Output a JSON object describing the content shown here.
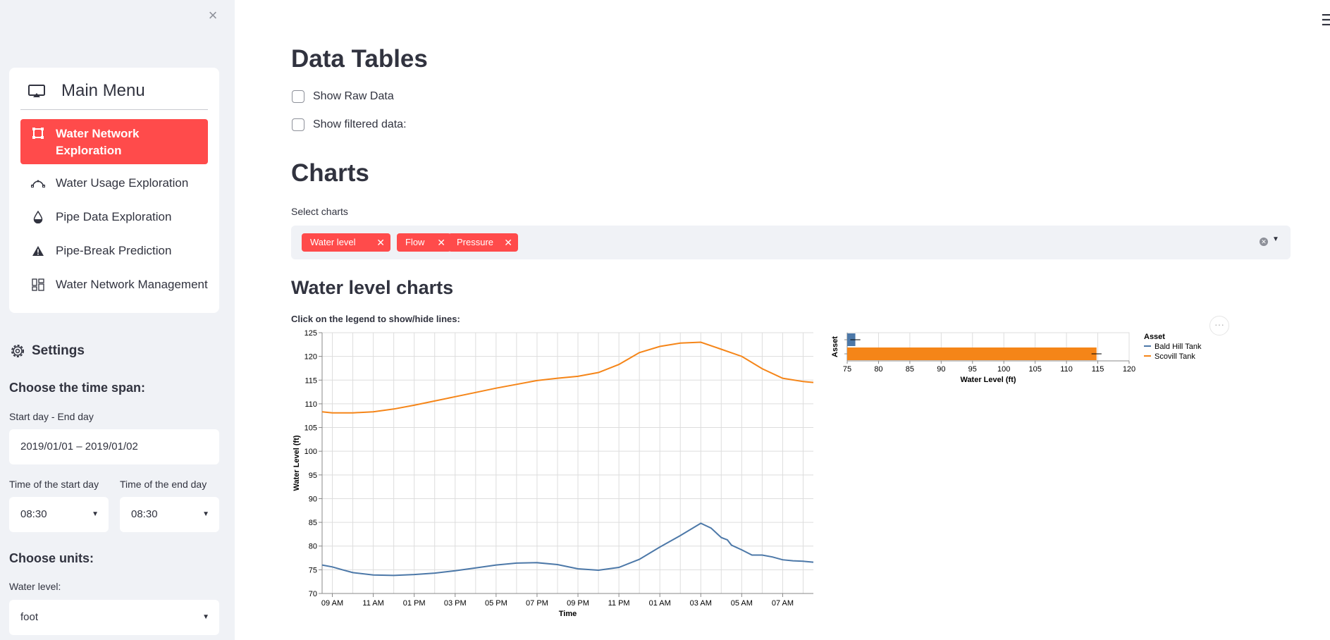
{
  "sidebar": {
    "close_icon": "close-icon",
    "menu": {
      "title": "Main Menu",
      "title_icon": "cast-icon",
      "items": [
        {
          "label": "Water Network Exploration",
          "icon": "bounding-box-icon",
          "active": true
        },
        {
          "label": "Water Usage Exploration",
          "icon": "bezier-icon",
          "active": false
        },
        {
          "label": "Pipe Data Exploration",
          "icon": "droplet-icon",
          "active": false
        },
        {
          "label": "Pipe-Break Prediction",
          "icon": "warning-icon",
          "active": false
        },
        {
          "label": "Water Network Management",
          "icon": "grid-icon",
          "active": false
        }
      ]
    },
    "settings": {
      "title": "Settings",
      "time_span_heading": "Choose the time span:",
      "date_range_label": "Start day - End day",
      "date_range_value": "2019/01/01 – 2019/01/02",
      "start_time_label": "Time of the start day",
      "start_time_value": "08:30",
      "end_time_label": "Time of the end day",
      "end_time_value": "08:30",
      "units_heading": "Choose units:",
      "water_level_label": "Water level:",
      "water_level_value": "foot"
    }
  },
  "main": {
    "data_tables_title": "Data Tables",
    "show_raw_label": "Show Raw Data",
    "show_filtered_label": "Show filtered data:",
    "charts_title": "Charts",
    "select_label": "Select charts",
    "selected_tags": [
      "Water level",
      "Flow",
      "Pressure"
    ],
    "water_level_title": "Water level charts",
    "chart_caption": "Click on the legend to show/hide lines:"
  },
  "colors": {
    "accent": "#ff4b4b",
    "bald_hill": "#4c78a8",
    "scovill": "#f58518"
  },
  "chart_data": [
    {
      "type": "line",
      "xlabel": "Time",
      "ylabel": "Water Level (ft)",
      "ylim": [
        70,
        125
      ],
      "yticks": [
        70,
        75,
        80,
        85,
        90,
        95,
        100,
        105,
        110,
        115,
        120,
        125
      ],
      "xticks_hours": [
        9,
        11,
        13,
        15,
        17,
        19,
        21,
        23,
        25,
        27,
        29,
        31
      ],
      "xtick_labels": [
        "09 AM",
        "11 AM",
        "01 PM",
        "03 PM",
        "05 PM",
        "07 PM",
        "09 PM",
        "11 PM",
        "01 AM",
        "03 AM",
        "05 AM",
        "07 AM"
      ],
      "xlim_hours": [
        8.5,
        32.5
      ],
      "grid": true,
      "series": [
        {
          "name": "Bald Hill Tank",
          "x": [
            8.5,
            9,
            9.5,
            10,
            11,
            12,
            13,
            14,
            15,
            16,
            17,
            18,
            19,
            20,
            21,
            22,
            23,
            24,
            25,
            26,
            27,
            27.5,
            28,
            28.3,
            28.5,
            29,
            29.5,
            30,
            30.5,
            31,
            31.5,
            32,
            32.5
          ],
          "y": [
            76,
            75.6,
            75,
            74.4,
            73.9,
            73.8,
            74,
            74.3,
            74.8,
            75.4,
            76,
            76.4,
            76.5,
            76.1,
            75.2,
            74.9,
            75.5,
            77.2,
            79.8,
            82.2,
            84.8,
            83.8,
            81.8,
            81.3,
            80.2,
            79.2,
            78.1,
            78.1,
            77.7,
            77.1,
            76.9,
            76.8,
            76.6
          ]
        },
        {
          "name": "Scovill Tank",
          "x": [
            8.5,
            9,
            10,
            11,
            12,
            13,
            14,
            15,
            16,
            17,
            18,
            19,
            20,
            21,
            22,
            23,
            24,
            25,
            26,
            27,
            28,
            29,
            30,
            31,
            32,
            32.5
          ],
          "y": [
            108.3,
            108.1,
            108.1,
            108.3,
            108.9,
            109.7,
            110.6,
            111.5,
            112.4,
            113.3,
            114.1,
            114.9,
            115.4,
            115.8,
            116.6,
            118.3,
            120.8,
            122.1,
            122.8,
            123,
            121.5,
            120,
            117.4,
            115.4,
            114.7,
            114.5
          ]
        }
      ]
    },
    {
      "type": "bar",
      "orientation": "horizontal",
      "xlabel": "Water Level (ft)",
      "ylabel": "Asset",
      "xlim": [
        75,
        120
      ],
      "xticks": [
        75,
        80,
        85,
        90,
        95,
        100,
        105,
        110,
        115,
        120
      ],
      "legend_title": "Asset",
      "legend_position": "right",
      "series": [
        {
          "name": "Bald Hill Tank",
          "value": 76.3,
          "err": 0.8
        },
        {
          "name": "Scovill Tank",
          "value": 114.8,
          "err": 0.8
        }
      ]
    }
  ]
}
